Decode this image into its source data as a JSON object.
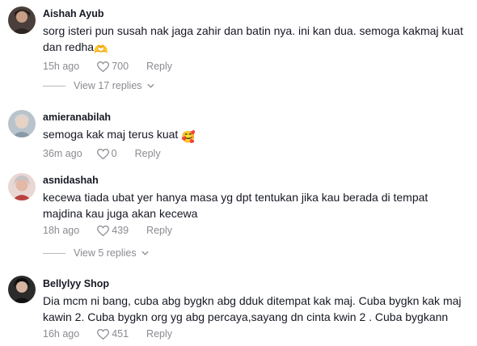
{
  "comments": [
    {
      "username": "Aishah Ayub",
      "text": "sorg isteri pun susah nak jaga zahir dan batin nya. ini kan dua. semoga kakmaj kuat dan redha",
      "emoji": "🫶",
      "time": "15h ago",
      "likes": "700",
      "reply_label": "Reply",
      "view_replies": "View 17 replies"
    },
    {
      "username": "amieranabilah",
      "text": "semoga kak maj terus kuat",
      "emoji": "🥰",
      "time": "36m ago",
      "likes": "0",
      "reply_label": "Reply"
    },
    {
      "username": "asnidashah",
      "text": "kecewa tiada ubat yer hanya masa yg dpt tentukan jika kau berada di tempat majdina kau juga akan kecewa",
      "time": "18h ago",
      "likes": "439",
      "reply_label": "Reply",
      "view_replies": "View 5 replies"
    },
    {
      "username": "Bellylyy Shop",
      "text": "Dia mcm ni bang, cuba abg bygkn abg dduk ditempat kak maj. Cuba bygkn kak maj kawin 2. Cuba bygkn org yg abg percaya,sayang dn cinta kwin 2 . Cuba bygkann",
      "time": "16h ago",
      "likes": "451",
      "reply_label": "Reply"
    }
  ],
  "icons": {
    "like": "heart-outline-icon",
    "chevron": "chevron-down-icon"
  },
  "colors": {
    "text": "#161823",
    "muted": "#8a8b91"
  }
}
